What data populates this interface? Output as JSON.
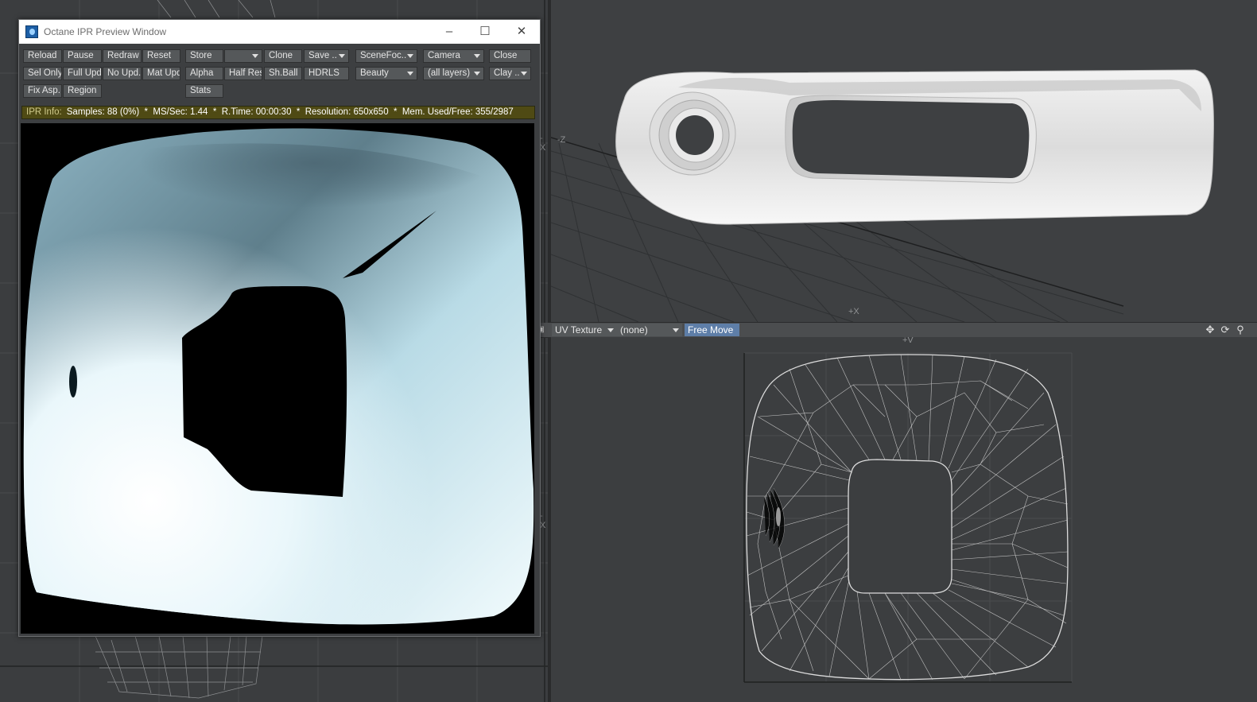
{
  "ipr_window": {
    "title": "Octane IPR Preview Window",
    "controls": {
      "minimize": "–",
      "maximize": "☐",
      "close": "✕"
    },
    "buttons_row1": {
      "reload": "Reload",
      "pause": "Pause",
      "redraw": "Redraw",
      "reset": "Reset",
      "store": "Store",
      "store_slot": "",
      "clone": "Clone",
      "save": "Save ..",
      "scene_focus": "SceneFoc..",
      "camera": "Camera",
      "close": "Close"
    },
    "buttons_row2": {
      "sel_only": "Sel Only",
      "full_upd": "Full Upd.",
      "no_upd": "No Upd.",
      "mat_upd": "Mat Upd",
      "alpha": "Alpha",
      "half_res": "Half Res",
      "sh_ball": "Sh.Ball",
      "hdrls": "HDRLS",
      "beauty": "Beauty",
      "layers": "(all layers)",
      "clay": "Clay .."
    },
    "buttons_row3": {
      "fix_asp": "Fix Asp.",
      "region": "Region",
      "stats": "Stats"
    },
    "info": {
      "label": "IPR Info:",
      "text": "Samples: 88 (0%)  *  MS/Sec: 1.44  *  R.Time: 00:00:30  *  Resolution: 650x650  *  Mem. Used/Free: 355/2987"
    }
  },
  "uv_toolbar": {
    "texture_mode": "UV Texture",
    "uv_map": "(none)",
    "free_move": "Free Move",
    "icons": [
      "move-icon",
      "rotate-icon",
      "zoom-icon"
    ]
  },
  "perspective_viewport": {
    "axis_labels": [
      "-Z",
      "+X"
    ]
  },
  "uv_viewport": {
    "axis_label": "+V"
  },
  "left_viewport": {
    "axis_labels": [
      "-X",
      "-X"
    ]
  },
  "colors": {
    "ipr_info_bar": "#4f4a14",
    "free_move_active": "#5e7ea8",
    "viewport_bg": "#3d3f41"
  }
}
